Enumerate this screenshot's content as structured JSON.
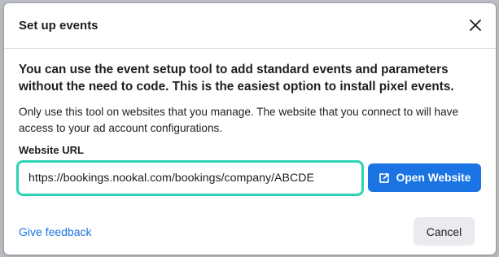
{
  "dialog": {
    "title": "Set up events",
    "close_icon": "close-icon",
    "lead_text": "You can use the event setup tool to add standard events and parameters without the need to code. This is the easiest option to install pixel events.",
    "description": "Only use this tool on websites that you manage. The website that you connect to will have access to your ad account configurations.",
    "url_field": {
      "label": "Website URL",
      "value": "https://bookings.nookal.com/bookings/company/ABCDE",
      "highlight_color": "#2ed3b4"
    },
    "open_website_button": {
      "label": "Open Website",
      "icon": "external-link-icon",
      "color": "#1b74e4"
    },
    "feedback_link": "Give feedback",
    "cancel_button": "Cancel"
  }
}
